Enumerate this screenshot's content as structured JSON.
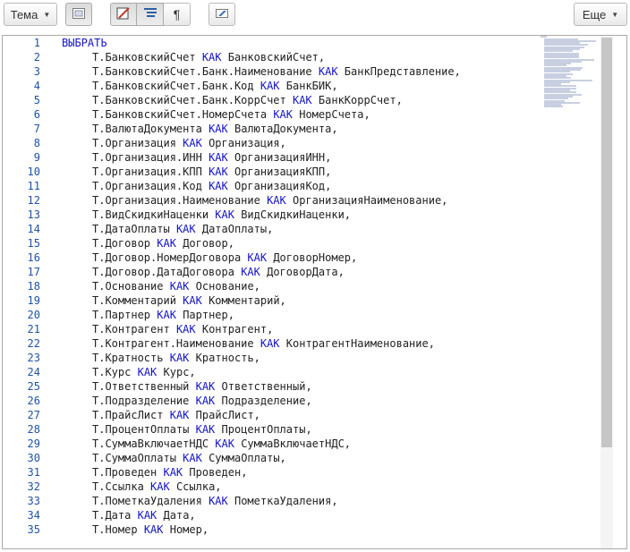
{
  "toolbar": {
    "theme_label": "Тема",
    "more_label": "Еще"
  },
  "editor": {
    "keyword_select": "ВЫБРАТЬ",
    "lines": [
      {
        "no": "1",
        "text": "ВЫБРАТЬ"
      },
      {
        "no": "2",
        "left": "Т.БанковскийСчет",
        "kw": "КАК",
        "right": "БанковскийСчет,"
      },
      {
        "no": "3",
        "left": "Т.БанковскийСчет.Банк.Наименование",
        "kw": "КАК",
        "right": "БанкПредставление,"
      },
      {
        "no": "4",
        "left": "Т.БанковскийСчет.Банк.Код",
        "kw": "КАК",
        "right": "БанкБИК,"
      },
      {
        "no": "5",
        "left": "Т.БанковскийСчет.Банк.КоррСчет",
        "kw": "КАК",
        "right": "БанкКоррСчет,"
      },
      {
        "no": "6",
        "left": "Т.БанковскийСчет.НомерСчета",
        "kw": "КАК",
        "right": "НомерСчета,"
      },
      {
        "no": "7",
        "left": "Т.ВалютаДокумента",
        "kw": "КАК",
        "right": "ВалютаДокумента,"
      },
      {
        "no": "8",
        "left": "Т.Организация",
        "kw": "КАК",
        "right": "Организация,"
      },
      {
        "no": "9",
        "left": "Т.Организация.ИНН",
        "kw": "КАК",
        "right": "ОрганизацияИНН,"
      },
      {
        "no": "10",
        "left": "Т.Организация.КПП",
        "kw": "КАК",
        "right": "ОрганизацияКПП,"
      },
      {
        "no": "11",
        "left": "Т.Организация.Код",
        "kw": "КАК",
        "right": "ОрганизацияКод,"
      },
      {
        "no": "12",
        "left": "Т.Организация.Наименование",
        "kw": "КАК",
        "right": "ОрганизацияНаименование,"
      },
      {
        "no": "13",
        "left": "Т.ВидСкидкиНаценки",
        "kw": "КАК",
        "right": "ВидСкидкиНаценки,"
      },
      {
        "no": "14",
        "left": "Т.ДатаОплаты",
        "kw": "КАК",
        "right": "ДатаОплаты,"
      },
      {
        "no": "15",
        "left": "Т.Договор",
        "kw": "КАК",
        "right": "Договор,"
      },
      {
        "no": "16",
        "left": "Т.Договор.НомерДоговора",
        "kw": "КАК",
        "right": "ДоговорНомер,"
      },
      {
        "no": "17",
        "left": "Т.Договор.ДатаДоговора",
        "kw": "КАК",
        "right": "ДоговорДата,"
      },
      {
        "no": "18",
        "left": "Т.Основание",
        "kw": "КАК",
        "right": "Основание,"
      },
      {
        "no": "19",
        "left": "Т.Комментарий",
        "kw": "КАК",
        "right": "Комментарий,"
      },
      {
        "no": "20",
        "left": "Т.Партнер",
        "kw": "КАК",
        "right": "Партнер,"
      },
      {
        "no": "21",
        "left": "Т.Контрагент",
        "kw": "КАК",
        "right": "Контрагент,"
      },
      {
        "no": "22",
        "left": "Т.Контрагент.Наименование",
        "kw": "КАК",
        "right": "КонтрагентНаименование,"
      },
      {
        "no": "23",
        "left": "Т.Кратность",
        "kw": "КАК",
        "right": "Кратность,"
      },
      {
        "no": "24",
        "left": "Т.Курс",
        "kw": "КАК",
        "right": "Курс,"
      },
      {
        "no": "25",
        "left": "Т.Ответственный",
        "kw": "КАК",
        "right": "Ответственный,"
      },
      {
        "no": "26",
        "left": "Т.Подразделение",
        "kw": "КАК",
        "right": "Подразделение,"
      },
      {
        "no": "27",
        "left": "Т.ПрайсЛист",
        "kw": "КАК",
        "right": "ПрайсЛист,"
      },
      {
        "no": "28",
        "left": "Т.ПроцентОплаты",
        "kw": "КАК",
        "right": "ПроцентОплаты,"
      },
      {
        "no": "29",
        "left": "Т.СуммаВключаетНДС",
        "kw": "КАК",
        "right": "СуммаВключаетНДС,"
      },
      {
        "no": "30",
        "left": "Т.СуммаОплаты",
        "kw": "КАК",
        "right": "СуммаОплаты,"
      },
      {
        "no": "31",
        "left": "Т.Проведен",
        "kw": "КАК",
        "right": "Проведен,"
      },
      {
        "no": "32",
        "left": "Т.Ссылка",
        "kw": "КАК",
        "right": "Ссылка,"
      },
      {
        "no": "33",
        "left": "Т.ПометкаУдаления",
        "kw": "КАК",
        "right": "ПометкаУдаления,"
      },
      {
        "no": "34",
        "left": "Т.Дата",
        "kw": "КАК",
        "right": "Дата,"
      },
      {
        "no": "35",
        "left": "Т.Номер",
        "kw": "КАК",
        "right": "Номер,"
      }
    ]
  },
  "colors": {
    "keyword": "#1414c8",
    "line_number": "#1f52a6",
    "text": "#222222"
  },
  "icons": {
    "form_toggle": "form-icon",
    "highlight_toggle": "highlight-pen-icon",
    "align_toggle": "align-left-icon",
    "pilcrow_toggle": "pilcrow-icon",
    "eraser": "eraser-icon"
  }
}
